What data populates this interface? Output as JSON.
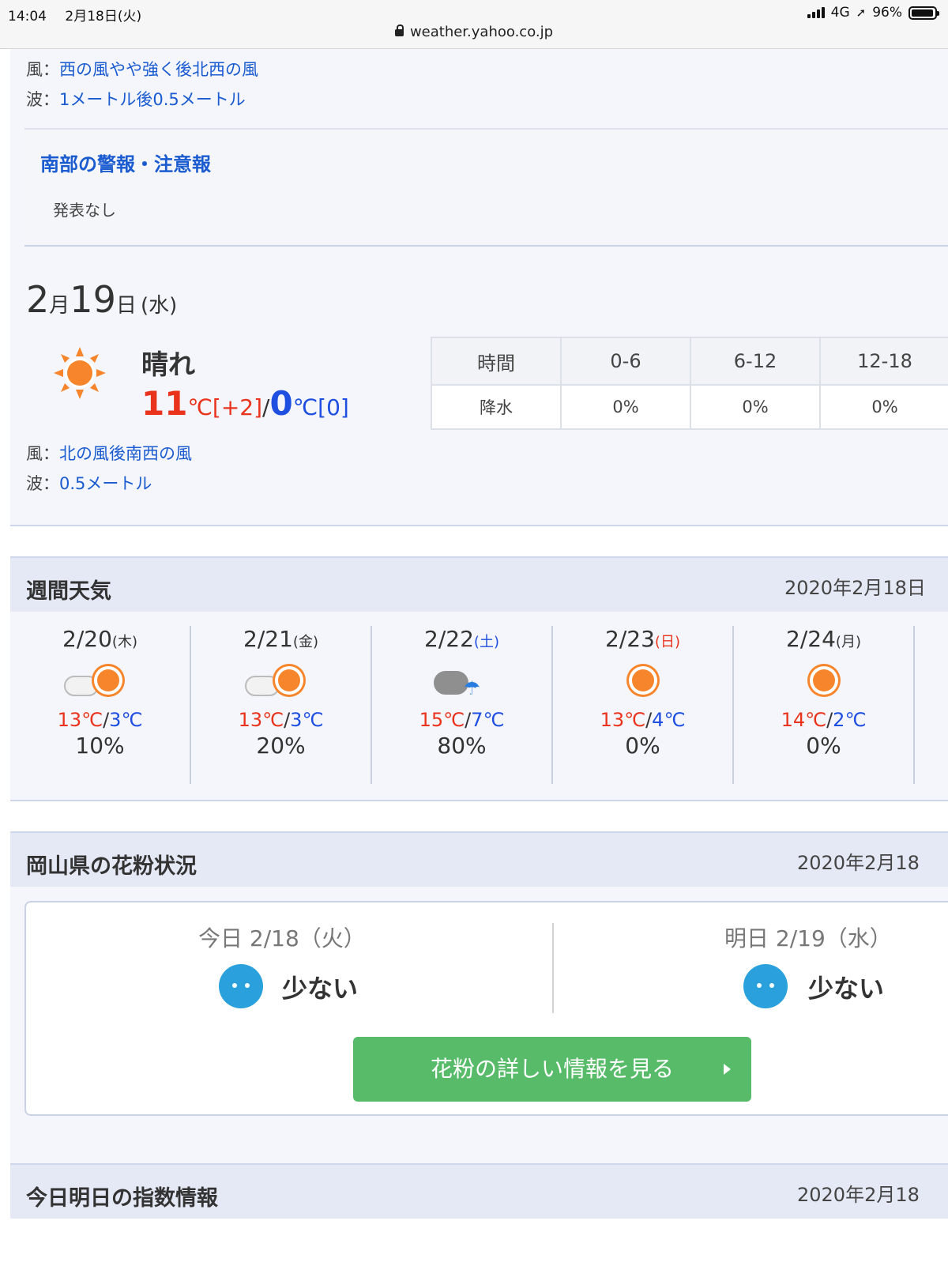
{
  "status": {
    "time": "14:04",
    "date": "2月18日(火)",
    "network": "4G",
    "battery": "96%",
    "url": "weather.yahoo.co.jp"
  },
  "top": {
    "wind_label": "風：",
    "wind": "西の風やや強く後北西の風",
    "wave_label": "波：",
    "wave": "1メートル後0.5メートル"
  },
  "warning": {
    "title": "南部の警報・注意報",
    "text": "発表なし"
  },
  "tomorrow": {
    "month": "2",
    "month_unit": "月",
    "day": "19",
    "day_unit": "日",
    "weekday": "(水)",
    "weather": "晴れ",
    "high": "11",
    "high_unit": "℃[+2]",
    "slash": "/",
    "low": "0",
    "low_unit": "℃[0]",
    "table": {
      "header": [
        "時間",
        "0-6",
        "6-12",
        "12-18"
      ],
      "row": [
        "降水",
        "0%",
        "0%",
        "0%"
      ]
    },
    "wind_label": "風：",
    "wind": "北の風後南西の風",
    "wave_label": "波：",
    "wave": "0.5メートル"
  },
  "weekly": {
    "title": "週間天気",
    "date": "2020年2月18日",
    "days": [
      {
        "date": "2/20",
        "wd": "(木)",
        "hi": "13℃",
        "lo": "3℃",
        "pct": "10%",
        "icon": "cloud-sun-icon"
      },
      {
        "date": "2/21",
        "wd": "(金)",
        "hi": "13℃",
        "lo": "3℃",
        "pct": "20%",
        "icon": "cloud-sun-icon"
      },
      {
        "date": "2/22",
        "wd": "(土)",
        "hi": "15℃",
        "lo": "7℃",
        "pct": "80%",
        "icon": "cloud-rain-icon"
      },
      {
        "date": "2/23",
        "wd": "(日)",
        "hi": "13℃",
        "lo": "4℃",
        "pct": "0%",
        "icon": "sun-icon"
      },
      {
        "date": "2/24",
        "wd": "(月)",
        "hi": "14℃",
        "lo": "2℃",
        "pct": "0%",
        "icon": "sun-icon"
      }
    ]
  },
  "pollen": {
    "title": "岡山県の花粉状況",
    "date": "2020年2月18",
    "today": {
      "label": "今日 2/18（火）",
      "level": "少ない"
    },
    "tomorrow": {
      "label": "明日 2/19（水）",
      "level": "少ない"
    },
    "button": "花粉の詳しい情報を見る"
  },
  "index": {
    "title": "今日明日の指数情報",
    "date": "2020年2月18"
  },
  "colors": {
    "link": "#1a5bd0",
    "hot": "#e9331c",
    "cold": "#1f4fe0",
    "button": "#58bb6a",
    "face": "#2aa0dc",
    "sun": "#f7852b"
  }
}
